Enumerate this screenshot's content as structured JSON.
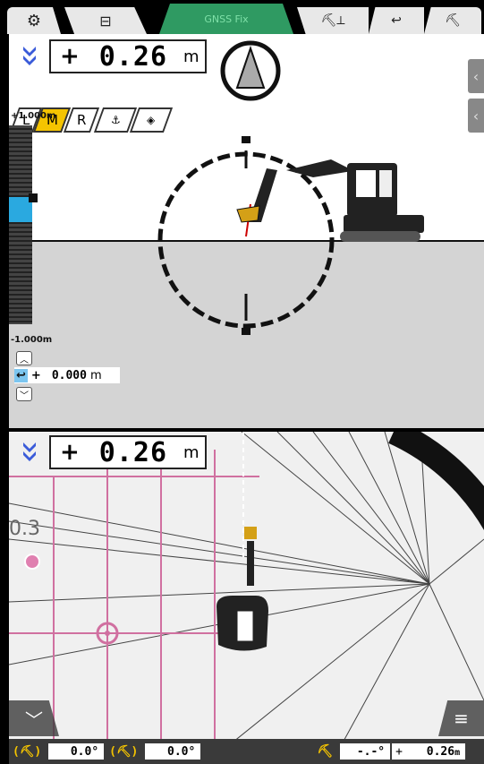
{
  "topbar": {
    "gnss_label": "GNSS Fix"
  },
  "upper": {
    "value": {
      "sign": "+",
      "number": "0.26",
      "unit": "m"
    },
    "modes": [
      "L",
      "M",
      "R"
    ],
    "active_mode": "M",
    "scale_top": "+1.000m",
    "scale_bottom": "-1.000m",
    "offset": {
      "sign": "+",
      "number": "0.000",
      "unit": "m"
    }
  },
  "lower": {
    "value": {
      "sign": "+",
      "number": "0.26",
      "unit": "m"
    },
    "map_label": "0.3"
  },
  "bottombar": {
    "pitch": "0.0°",
    "roll": "0.0°",
    "bucket_angle": "-.-°",
    "bucket_sign": "+",
    "bucket_height": "0.26",
    "bucket_unit": "m"
  },
  "colors": {
    "accent": "#f5c400",
    "gnss": "#2f9a62",
    "indicator": "#3a5bd9",
    "grid": "#d070a0"
  }
}
